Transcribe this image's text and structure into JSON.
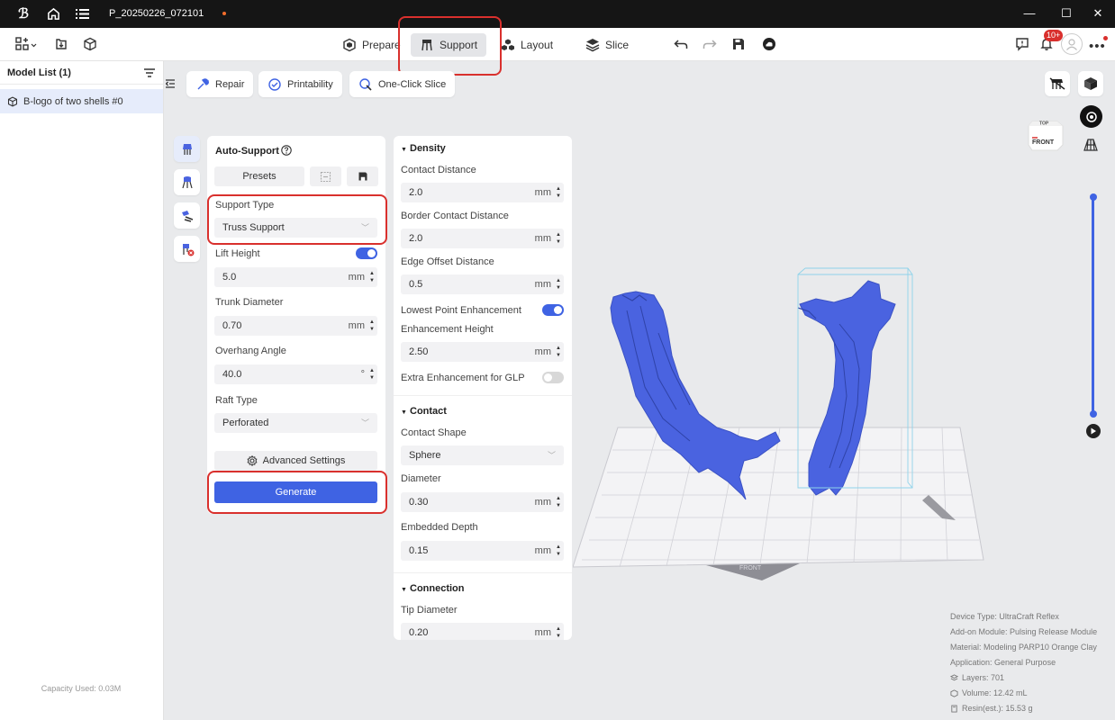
{
  "titlebar": {
    "project_title": "P_20250226_072101",
    "minimize": "—",
    "maximize": "☐",
    "close": "✕"
  },
  "toolbar": {
    "tabs": [
      {
        "label": "Prepare",
        "icon": "prepare-icon"
      },
      {
        "label": "Support",
        "icon": "support-icon",
        "active": true
      },
      {
        "label": "Layout",
        "icon": "layout-icon"
      },
      {
        "label": "Slice",
        "icon": "slice-icon"
      }
    ],
    "notification_badge": "10+"
  },
  "sidebar": {
    "title": "Model List (1)",
    "items": [
      {
        "label": "B-logo of two shells #0"
      }
    ],
    "capacity": "Capacity Used: 0.03M"
  },
  "functions": [
    {
      "label": "Repair"
    },
    {
      "label": "Printability"
    },
    {
      "label": "One-Click Slice"
    }
  ],
  "auto_support": {
    "title": "Auto-Support",
    "presets_label": "Presets",
    "support_type_label": "Support Type",
    "support_type_value": "Truss Support",
    "lift_height_label": "Lift Height",
    "lift_height_on": true,
    "lift_height_value": "5.0",
    "trunk_diameter_label": "Trunk Diameter",
    "trunk_diameter_value": "0.70",
    "overhang_angle_label": "Overhang Angle",
    "overhang_angle_value": "40.0",
    "raft_type_label": "Raft Type",
    "raft_type_value": "Perforated",
    "advanced_label": "Advanced Settings",
    "generate_label": "Generate",
    "unit_mm": "mm",
    "unit_deg": "°"
  },
  "density": {
    "title": "Density",
    "contact_distance_label": "Contact Distance",
    "contact_distance_value": "2.0",
    "border_contact_label": "Border Contact Distance",
    "border_contact_value": "2.0",
    "edge_offset_label": "Edge Offset Distance",
    "edge_offset_value": "0.5",
    "lowest_point_label": "Lowest Point Enhancement",
    "lowest_point_on": true,
    "enh_height_label": "Enhancement Height",
    "enh_height_value": "2.50",
    "extra_glp_label": "Extra Enhancement for GLP",
    "extra_glp_on": false
  },
  "contact": {
    "title": "Contact",
    "shape_label": "Contact Shape",
    "shape_value": "Sphere",
    "diameter_label": "Diameter",
    "diameter_value": "0.30",
    "embedded_label": "Embedded Depth",
    "embedded_value": "0.15"
  },
  "connection": {
    "title": "Connection",
    "tip_diameter_label": "Tip Diameter",
    "tip_diameter_value": "0.20"
  },
  "viewport": {
    "cube_top": "TOP",
    "cube_front": "FRONT",
    "plate_front": "FRONT"
  },
  "info": {
    "device": "Device Type:  UltraCraft Reflex",
    "addon": "Add-on Module:  Pulsing Release Module",
    "material": "Material:  Modeling PARP10 Orange Clay",
    "application": "Application:  General Purpose",
    "layers": "Layers: 701",
    "volume": "Volume: 12.42 mL",
    "resin": "Resin(est.): 15.53 g"
  },
  "colors": {
    "accent": "#3f63e3",
    "highlight": "#d9302d",
    "model": "#4a63e0"
  }
}
